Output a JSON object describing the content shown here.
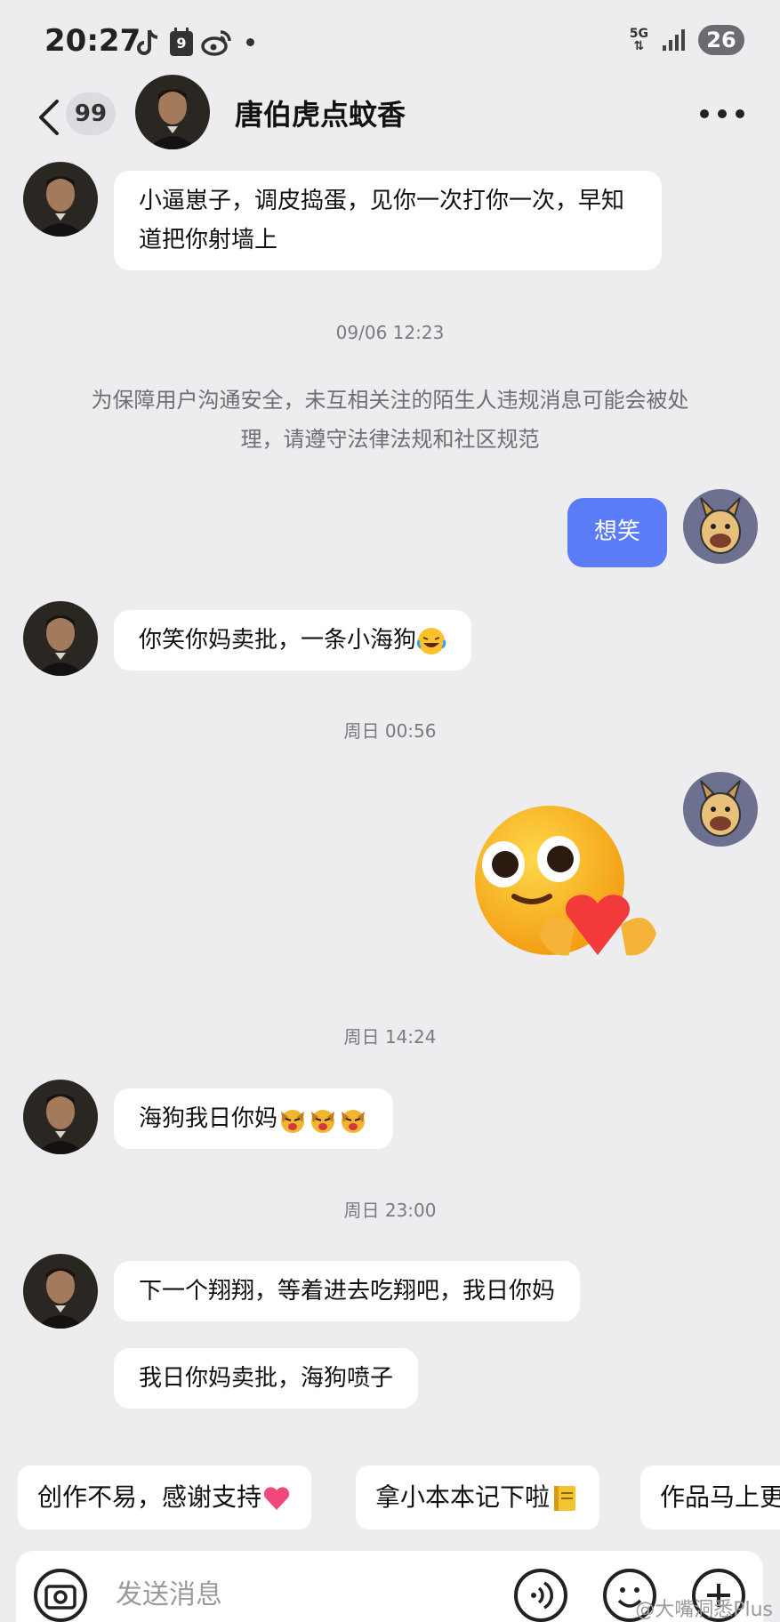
{
  "status_bar": {
    "time": "20:27",
    "calendar_day": "9",
    "network": "5G",
    "battery": "26",
    "icons": [
      "tiktok-icon",
      "calendar-icon",
      "weibo-icon",
      "dot-icon",
      "signal-icon"
    ]
  },
  "header": {
    "unread_count": "99",
    "contact_name": "唐伯虎点蚊香"
  },
  "messages": [
    {
      "side": "left",
      "text": "小逼崽子，调皮捣蛋，见你一次打你一次，早知道把你射墙上"
    },
    {
      "type": "timestamp",
      "text": "09/06 12:23"
    },
    {
      "type": "notice",
      "text": "为保障用户沟通安全，未互相关注的陌生人违规消息可能会被处理，请遵守法律法规和社区规范"
    },
    {
      "side": "right",
      "text": "想笑"
    },
    {
      "side": "left",
      "text": "你笑你妈卖批，一条小海狗",
      "emoji": "laughing-crying-emoji"
    },
    {
      "type": "timestamp",
      "text": "周日 00:56"
    },
    {
      "side": "right",
      "sticker": "smiley-holding-heart-sticker"
    },
    {
      "type": "timestamp",
      "text": "周日 14:24"
    },
    {
      "side": "left",
      "text": "海狗我日你妈",
      "emoji": "angry-dog-emoji-x3"
    },
    {
      "type": "timestamp",
      "text": "周日 23:00"
    },
    {
      "side": "left",
      "text": "下一个翔翔，等着进去吃翔吧，我日你妈"
    },
    {
      "side": "left",
      "text": "我日你妈卖批，海狗喷子"
    }
  ],
  "quick_replies": [
    {
      "label": "创作不易，感谢支持",
      "emoji": "heart-emoji"
    },
    {
      "label": "拿小本本记下啦",
      "emoji": "notebook-emoji"
    },
    {
      "label": "作品马上更"
    }
  ],
  "input": {
    "placeholder": "发送消息"
  },
  "watermark": "@大嘴洞悉Plus",
  "colors": {
    "background": "#ededef",
    "my_bubble": "#5b7cf7",
    "bubble": "#ffffff"
  }
}
